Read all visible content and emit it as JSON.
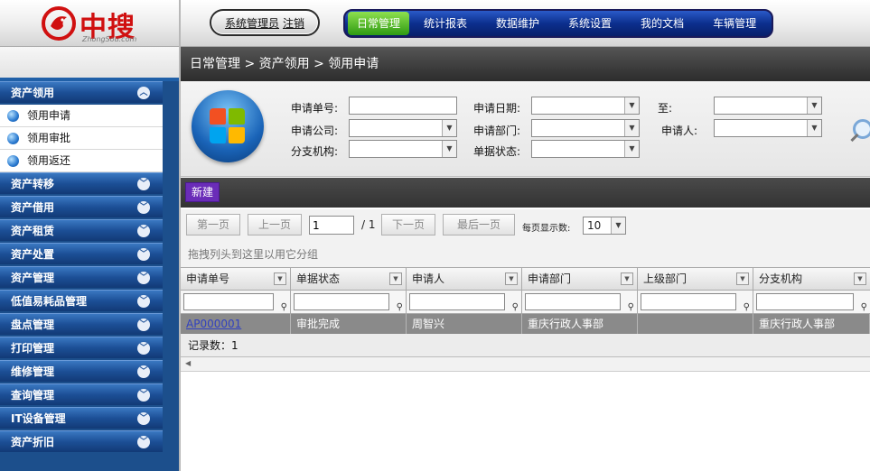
{
  "brand": {
    "name": "中搜",
    "sub": "ZhongSou.com",
    "accent": "#d01010"
  },
  "header": {
    "user": {
      "name": "系统管理员",
      "logout": "注销"
    },
    "nav": [
      {
        "label": "日常管理",
        "active": true
      },
      {
        "label": "统计报表"
      },
      {
        "label": "数据维护"
      },
      {
        "label": "系统设置"
      },
      {
        "label": "我的文档"
      },
      {
        "label": "车辆管理"
      }
    ]
  },
  "sidebar": {
    "groups": [
      {
        "label": "资产领用",
        "expanded": true,
        "items": [
          "领用申请",
          "领用审批",
          "领用返还"
        ]
      },
      {
        "label": "资产转移"
      },
      {
        "label": "资产借用"
      },
      {
        "label": "资产租赁"
      },
      {
        "label": "资产处置"
      },
      {
        "label": "资产管理"
      },
      {
        "label": "低值易耗品管理"
      },
      {
        "label": "盘点管理"
      },
      {
        "label": "打印管理"
      },
      {
        "label": "维修管理"
      },
      {
        "label": "查询管理"
      },
      {
        "label": "IT设备管理"
      },
      {
        "label": "资产折旧"
      }
    ]
  },
  "breadcrumb": "日常管理 > 资产领用 > 领用申请",
  "search": {
    "apply_no": "申请单号:",
    "apply_date": "申请日期:",
    "to": "至:",
    "company": "申请公司:",
    "dept": "申请部门:",
    "applicant": "申请人:",
    "branch": "分支机构:",
    "status": "单据状态:"
  },
  "toolbar": {
    "new": "新建"
  },
  "pager": {
    "first": "第一页",
    "prev": "上一页",
    "page": "1",
    "total": "/ 1",
    "next": "下一页",
    "last": "最后一页",
    "per_page_label": "每页显示数:",
    "per_page": "10"
  },
  "group_hint": "拖拽列头到这里以用它分组",
  "grid": {
    "columns": [
      "申请单号",
      "单据状态",
      "申请人",
      "申请部门",
      "上级部门",
      "分支机构"
    ],
    "rows": [
      [
        "AP000001",
        "审批完成",
        "周智兴",
        "重庆行政人事部",
        "",
        "重庆行政人事部"
      ]
    ],
    "record_label": "记录数：",
    "record_count": "1"
  }
}
